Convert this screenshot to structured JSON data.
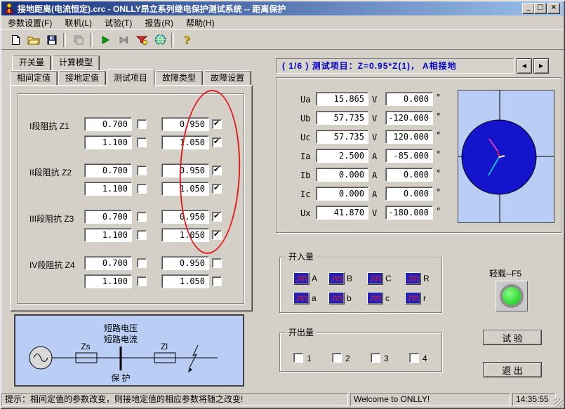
{
  "window": {
    "title": "接地距离(电流恒定).crc - ONLLY昂立系列继电保护测试系统 -- 距离保护",
    "controls": {
      "minimize": "_",
      "maximize": "□",
      "close": "×"
    }
  },
  "menu": {
    "items": [
      "参数设置(F)",
      "联机(L)",
      "试验(T)",
      "报告(R)",
      "帮助(H)"
    ]
  },
  "toolbar": {
    "icons": [
      "new-file",
      "open-folder",
      "save",
      "window-copy",
      "run",
      "step-forward",
      "report",
      "globe",
      "help"
    ],
    "help_glyph": "?"
  },
  "tabs": {
    "row1": [
      "开关量",
      "计算模型"
    ],
    "row2": [
      "相间定值",
      "接地定值",
      "测试项目",
      "故障类型",
      "故障设置"
    ],
    "active": "测试项目"
  },
  "impedance": {
    "groups": [
      {
        "label": "I段阻抗 Z1",
        "rows": [
          {
            "v1": "0.700",
            "c1": false,
            "v2": "0.950",
            "c2": true
          },
          {
            "v1": "1.100",
            "c1": false,
            "v2": "1.050",
            "c2": true
          }
        ]
      },
      {
        "label": "II段阻抗 Z2",
        "rows": [
          {
            "v1": "0.700",
            "c1": false,
            "v2": "0.950",
            "c2": true
          },
          {
            "v1": "1.100",
            "c1": false,
            "v2": "1.050",
            "c2": true
          }
        ]
      },
      {
        "label": "III段阻抗 Z3",
        "rows": [
          {
            "v1": "0.700",
            "c1": false,
            "v2": "0.950",
            "c2": true
          },
          {
            "v1": "1.100",
            "c1": false,
            "v2": "1.050",
            "c2": true
          }
        ]
      },
      {
        "label": "IV段阻抗 Z4",
        "rows": [
          {
            "v1": "0.700",
            "c1": false,
            "v2": "0.950",
            "c2": false
          },
          {
            "v1": "1.100",
            "c1": false,
            "v2": "1.050",
            "c2": false
          }
        ]
      }
    ]
  },
  "circuit": {
    "label_top1": "短路电压",
    "label_top2": "短路电流",
    "impedance_source": "Zs",
    "impedance_line": "Zl",
    "label_bottom": "保 护"
  },
  "test_header": {
    "text": "(  1/6  ) 测试项目：Z=0.95*Z(1)，  A相接地",
    "prev": "◄",
    "next": "►"
  },
  "readings": {
    "deg": "°",
    "rows": [
      {
        "label": "Ua",
        "value": "15.865",
        "unit": "V",
        "angle": "0.000"
      },
      {
        "label": "Ub",
        "value": "57.735",
        "unit": "V",
        "angle": "-120.000"
      },
      {
        "label": "Uc",
        "value": "57.735",
        "unit": "V",
        "angle": "120.000"
      },
      {
        "label": "Ia",
        "value": "2.500",
        "unit": "A",
        "angle": "-85.000"
      },
      {
        "label": "Ib",
        "value": "0.000",
        "unit": "A",
        "angle": "0.000"
      },
      {
        "label": "Ic",
        "value": "0.000",
        "unit": "A",
        "angle": "0.000"
      },
      {
        "label": "Ux",
        "value": "41.870",
        "unit": "V",
        "angle": "-180.000"
      }
    ]
  },
  "binary_inputs": {
    "title": "开入量",
    "labels": [
      "A",
      "B",
      "C",
      "R",
      "a",
      "b",
      "c",
      "r"
    ]
  },
  "binary_outputs": {
    "title": "开出量",
    "items": [
      {
        "label": "1",
        "checked": false
      },
      {
        "label": "2",
        "checked": false
      },
      {
        "label": "3",
        "checked": false
      },
      {
        "label": "4",
        "checked": false
      }
    ]
  },
  "light_load": {
    "label": "轻载--F5"
  },
  "actions": {
    "test": "试 验",
    "exit": "退 出"
  },
  "statusbar": {
    "hint": "提示：相间定值的参数改变，则接地定值的相应参数将随之改变!",
    "welcome": "Welcome to ONLLY!",
    "time": "14:35:55"
  },
  "colors": {
    "titlebar_gradient_left": "#17327e",
    "titlebar_gradient_right": "#9dc1ea",
    "annotation_red": "#e02020",
    "led_green": "#2ed32e",
    "phasor_blue": "#1414cc",
    "diagram_bg_blue": "#b9cdf5",
    "header_text_blue": "#0000cc",
    "indicator_blue": "#2020bb",
    "pulse_red": "#e02020"
  }
}
